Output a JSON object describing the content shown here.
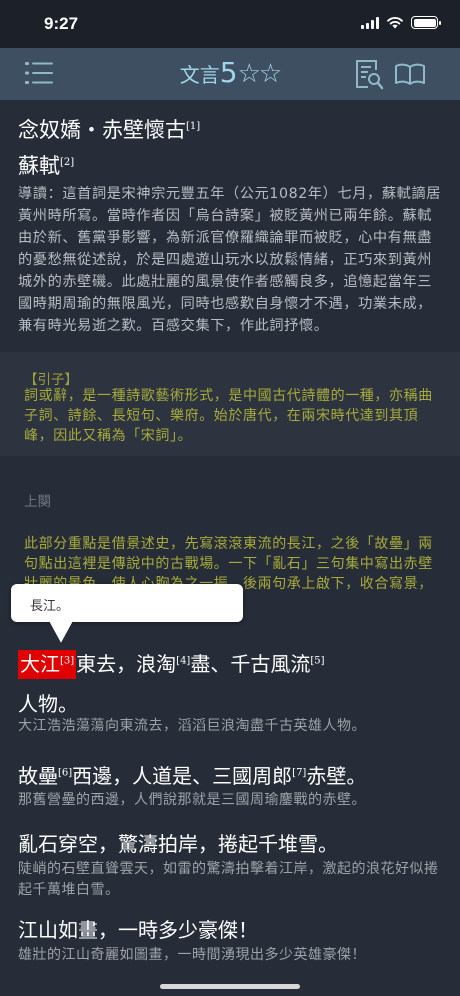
{
  "status": {
    "time": "9:27"
  },
  "toolbar": {
    "title_1": "文言",
    "title_2": "5",
    "title_3": "☆☆"
  },
  "poem": {
    "title": "念奴嬌‧赤壁懷古",
    "title_note": "[1]",
    "author": "蘇軾",
    "author_note": "[2]",
    "intro": "導讀：這首詞是宋神宗元豐五年（公元1082年）七月，蘇軾謫居黃州時所寫。當時作者因「烏台詩案」被貶黃州已兩年餘。蘇軾由於新、舊黨爭影響，為新派官僚羅織論罪而被貶，心中有無盡的憂愁無從述說，於是四處遊山玩水以放鬆情緒，正巧來到黃州城外的赤壁磯。此處壯麗的風景使作者感觸良多，追憶起當年三國時期周瑜的無限風光，同時也感歎自身懷才不遇，功業未成，兼有時光易逝之歎。百感交集下，作此詞抒懷。"
  },
  "yinzi": {
    "title": "【引子】",
    "text": "詞或辭，是一種詩歌藝術形式，是中國古代詩體的一種，亦稱曲子詞、詩餘、長短句、樂府。始於唐代，在兩宋時代達到其頂峰，因此又稱為「宋詞」。"
  },
  "section": {
    "label": "上闋",
    "text": "此部分重點是借景述史，先寫滾滾東流的長江，之後「故壘」兩句點出這裡是傳說中的古戰場。一下「亂石」三句集中寫出赤壁壯麗的景色，使人心胸為之一振。後兩句承上啟下，收合寫景，引起下闋對人的感慨。"
  },
  "tooltip": {
    "text": "長江。"
  },
  "lines": [
    {
      "highlight": "大江",
      "hl_note": "[3]",
      "p1": "東去，浪淘",
      "n1": "[4]",
      "p2": "盡、千古風流",
      "n2": "[5]"
    },
    {
      "text": "人物。",
      "trans": "大江浩浩蕩蕩向東流去，滔滔巨浪淘盡千古英雄人物。"
    },
    {
      "p1": "故壘",
      "n1": "[6]",
      "p2": "西邊，人道是、三國周郎",
      "n2": "[7]",
      "p3": "赤壁。",
      "trans": "那舊營壘的西邊，人們說那就是三國周瑜鏖戰的赤壁。"
    },
    {
      "text": "亂石穿空，驚濤拍岸，捲起千堆雪。",
      "trans": "陡峭的石壁直聳雲天，如雷的驚濤拍擊着江岸，激起的浪花好似捲起千萬堆白雪。"
    },
    {
      "text": "江山如畫，一時多少豪傑！",
      "trans": "雄壯的江山奇麗如圖畫，一時間湧現出多少英雄豪傑！"
    }
  ],
  "colors": {
    "background": "#262d38",
    "toolbar": "#3f4f62",
    "accent": "#9fd6ea",
    "commentary": "#a8ab3a",
    "highlight": "#e00000"
  },
  "icons": [
    "list-menu-icon",
    "search-document-icon",
    "open-book-icon",
    "signal-icon",
    "wifi-icon",
    "battery-icon",
    "star-outline-icon"
  ]
}
